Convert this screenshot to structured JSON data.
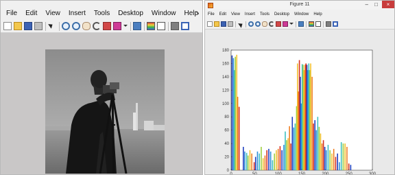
{
  "left_window": {
    "menu": [
      "File",
      "Edit",
      "View",
      "Insert",
      "Tools",
      "Desktop",
      "Window",
      "Help"
    ],
    "dock_arrow": "↘",
    "image_alt": "cameraman grayscale photo"
  },
  "right_window": {
    "title": "Figure 11",
    "controls": {
      "minimize": "–",
      "maximize": "□",
      "close": "×"
    },
    "menu": [
      "File",
      "Edit",
      "View",
      "Insert",
      "Tools",
      "Desktop",
      "Window",
      "Help"
    ]
  },
  "chart_data": {
    "type": "bar",
    "title": "",
    "xlabel": "",
    "ylabel": "",
    "xlim": [
      0,
      300
    ],
    "ylim": [
      0,
      180
    ],
    "xticks": [
      0,
      50,
      100,
      150,
      200,
      250,
      300
    ],
    "yticks": [
      0,
      20,
      40,
      60,
      80,
      100,
      120,
      140,
      160,
      180
    ],
    "grid": false,
    "colors": [
      "#1f3fbf",
      "#2f8fd8",
      "#3fbfbf",
      "#9fcf3f",
      "#f2c12e",
      "#ef7f22",
      "#d7301f"
    ],
    "bars": [
      {
        "x": 2,
        "y": 172
      },
      {
        "x": 5,
        "y": 168
      },
      {
        "x": 7,
        "y": 150
      },
      {
        "x": 9,
        "y": 170
      },
      {
        "x": 12,
        "y": 173
      },
      {
        "x": 14,
        "y": 110
      },
      {
        "x": 17,
        "y": 95
      },
      {
        "x": 26,
        "y": 35
      },
      {
        "x": 29,
        "y": 28
      },
      {
        "x": 33,
        "y": 26
      },
      {
        "x": 36,
        "y": 22
      },
      {
        "x": 40,
        "y": 30
      },
      {
        "x": 44,
        "y": 25
      },
      {
        "x": 49,
        "y": 12
      },
      {
        "x": 52,
        "y": 20
      },
      {
        "x": 56,
        "y": 28
      },
      {
        "x": 60,
        "y": 25
      },
      {
        "x": 64,
        "y": 35
      },
      {
        "x": 68,
        "y": 18
      },
      {
        "x": 72,
        "y": 22
      },
      {
        "x": 76,
        "y": 30
      },
      {
        "x": 80,
        "y": 32
      },
      {
        "x": 84,
        "y": 28
      },
      {
        "x": 88,
        "y": 15
      },
      {
        "x": 92,
        "y": 25
      },
      {
        "x": 96,
        "y": 30
      },
      {
        "x": 100,
        "y": 32
      },
      {
        "x": 104,
        "y": 36
      },
      {
        "x": 108,
        "y": 30
      },
      {
        "x": 112,
        "y": 38
      },
      {
        "x": 115,
        "y": 58
      },
      {
        "x": 118,
        "y": 45
      },
      {
        "x": 121,
        "y": 48
      },
      {
        "x": 124,
        "y": 66
      },
      {
        "x": 127,
        "y": 40
      },
      {
        "x": 130,
        "y": 80
      },
      {
        "x": 133,
        "y": 64
      },
      {
        "x": 136,
        "y": 70
      },
      {
        "x": 139,
        "y": 96
      },
      {
        "x": 141,
        "y": 160
      },
      {
        "x": 143,
        "y": 118
      },
      {
        "x": 145,
        "y": 165
      },
      {
        "x": 147,
        "y": 140
      },
      {
        "x": 149,
        "y": 100
      },
      {
        "x": 151,
        "y": 159
      },
      {
        "x": 153,
        "y": 158
      },
      {
        "x": 155,
        "y": 150
      },
      {
        "x": 157,
        "y": 158
      },
      {
        "x": 159,
        "y": 160
      },
      {
        "x": 161,
        "y": 158
      },
      {
        "x": 163,
        "y": 150
      },
      {
        "x": 165,
        "y": 160
      },
      {
        "x": 167,
        "y": 150
      },
      {
        "x": 169,
        "y": 160
      },
      {
        "x": 172,
        "y": 140
      },
      {
        "x": 175,
        "y": 70
      },
      {
        "x": 178,
        "y": 75
      },
      {
        "x": 181,
        "y": 60
      },
      {
        "x": 184,
        "y": 80
      },
      {
        "x": 187,
        "y": 65
      },
      {
        "x": 190,
        "y": 55
      },
      {
        "x": 193,
        "y": 40
      },
      {
        "x": 196,
        "y": 45
      },
      {
        "x": 199,
        "y": 35
      },
      {
        "x": 202,
        "y": 30
      },
      {
        "x": 206,
        "y": 38
      },
      {
        "x": 210,
        "y": 30
      },
      {
        "x": 214,
        "y": 25
      },
      {
        "x": 218,
        "y": 32
      },
      {
        "x": 222,
        "y": 20
      },
      {
        "x": 226,
        "y": 25
      },
      {
        "x": 230,
        "y": 12
      },
      {
        "x": 234,
        "y": 42
      },
      {
        "x": 238,
        "y": 40
      },
      {
        "x": 242,
        "y": 40
      },
      {
        "x": 246,
        "y": 35
      },
      {
        "x": 250,
        "y": 10
      },
      {
        "x": 254,
        "y": 8
      }
    ]
  }
}
